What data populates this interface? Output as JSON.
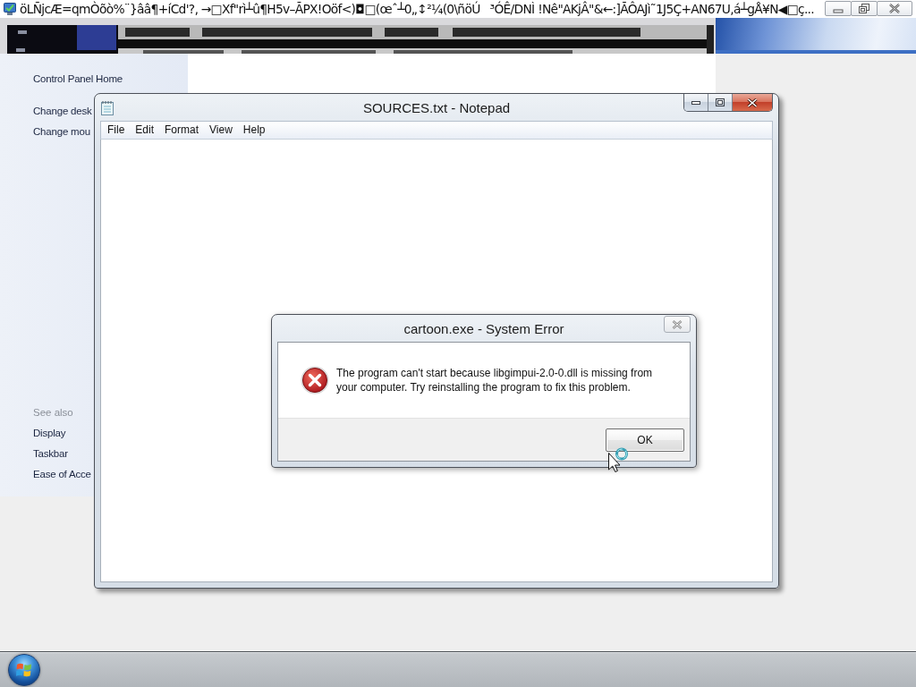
{
  "top_window": {
    "title": "öLÑjcÆ=qmÒõò%¨}ââ¶+íCd'?‚ →□Xf\"rì┴û¶H5v–ÃPX!Oöf<)◘□(œˆ┴0„↕²¼(0\\ñöÚ   ³ÓÊ/DNÌ !Nê\"AKjÂ\"&←:]ÃÔAJì˜1J5Ç+AN67U,á┴gÅ¥N◀□ç..."
  },
  "control_panel": {
    "sidebar": {
      "items": [
        {
          "label": "Control Panel Home"
        },
        {
          "label": "Change desk"
        },
        {
          "label": "Change mou"
        }
      ]
    },
    "see_also": {
      "heading": "See also",
      "items": [
        {
          "label": "Display"
        },
        {
          "label": "Taskbar"
        },
        {
          "label": "Ease of Acce"
        }
      ]
    }
  },
  "notepad": {
    "title": "SOURCES.txt - Notepad",
    "menu": [
      "File",
      "Edit",
      "Format",
      "View",
      "Help"
    ]
  },
  "dialog": {
    "title": "cartoon.exe - System Error",
    "message": "The program can't start because libgimpui-2.0-0.dll is missing from your computer. Try reinstalling the program to fix this problem.",
    "buttons": [
      "OK"
    ]
  }
}
